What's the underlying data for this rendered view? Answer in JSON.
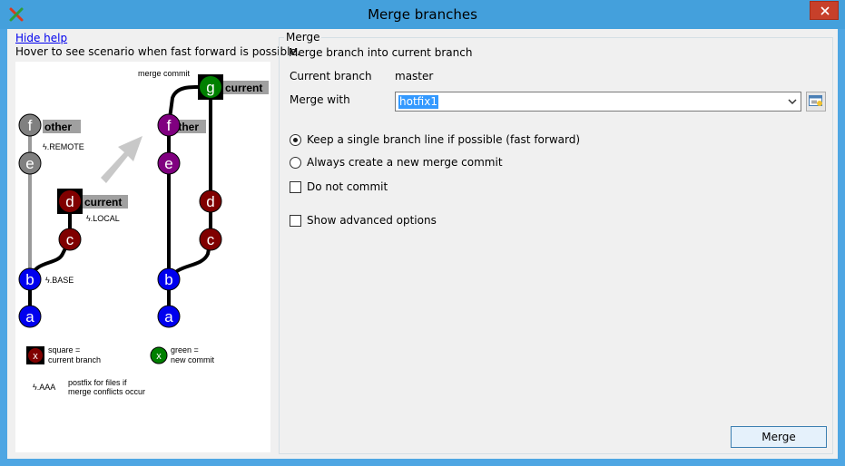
{
  "window": {
    "title": "Merge branches",
    "accent_color": "#44a0dc",
    "close_color": "#c7402a"
  },
  "help": {
    "link_label": "Hide help",
    "hint": "Hover to see scenario when fast forward is possible."
  },
  "diagram": {
    "left": {
      "nodes": [
        "f",
        "e",
        "d",
        "c",
        "b",
        "a"
      ],
      "tags": {
        "other": "other",
        "current": "current"
      },
      "postfixes": {
        "remote": ".REMOTE",
        "local": ".LOCAL",
        "base": ".BASE"
      }
    },
    "right": {
      "caption": "merge commit",
      "nodes": [
        "g",
        "f",
        "e",
        "d",
        "c",
        "b",
        "a"
      ],
      "tags": {
        "current": "current",
        "other": "other"
      }
    },
    "legend": {
      "square_label_1": "square =",
      "square_label_2": "current branch",
      "square_glyph": "x",
      "green_label_1": "green =",
      "green_label_2": "new commit",
      "green_glyph": "x",
      "postfix_glyph": ".AAA",
      "postfix_label_1": "postfix for files if",
      "postfix_label_2": "merge conflicts occur"
    },
    "colors": {
      "gray": "#808080",
      "purple": "#800080",
      "darkred": "#800000",
      "blue": "#0000ee",
      "green": "#008000"
    }
  },
  "merge": {
    "group_title": "Merge",
    "description": "Merge branch into current branch",
    "current_branch_label": "Current branch",
    "current_branch_value": "master",
    "merge_with_label": "Merge with",
    "merge_with_value": "hotfix1",
    "option_fast_forward": "Keep a single branch line if possible (fast forward)",
    "option_new_commit": "Always create a new merge commit",
    "option_no_commit": "Do not commit",
    "option_advanced": "Show advanced options",
    "merge_button": "Merge"
  }
}
